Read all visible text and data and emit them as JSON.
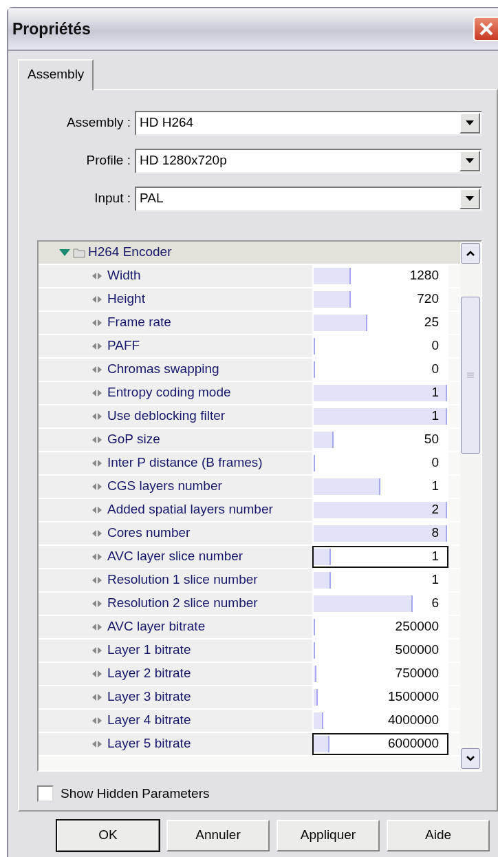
{
  "window": {
    "title": "Propriétés"
  },
  "tabs": [
    {
      "label": "Assembly",
      "selected": true
    }
  ],
  "selectors": [
    {
      "label": "Assembly :",
      "value": "HD H264"
    },
    {
      "label": "Profile :",
      "value": "HD 1280x720p"
    },
    {
      "label": "Input :",
      "value": "PAL"
    }
  ],
  "property_grid": {
    "groups": [
      {
        "label": "H264 Encoder",
        "expanded": true,
        "children": [
          {
            "label": "Width",
            "value": "1280",
            "level": 0.28,
            "editing": false
          },
          {
            "label": "Height",
            "value": "720",
            "level": 0.28,
            "editing": false
          },
          {
            "label": "Frame rate",
            "value": "25",
            "level": 0.4,
            "editing": false
          },
          {
            "label": "PAFF",
            "value": "0",
            "level": 0.01,
            "editing": false
          },
          {
            "label": "Chromas swapping",
            "value": "0",
            "level": 0,
            "editing": false
          },
          {
            "label": "Entropy coding mode",
            "value": "1",
            "level": 1,
            "editing": false
          },
          {
            "label": "Use deblocking filter",
            "value": "1",
            "level": 1,
            "editing": false
          },
          {
            "label": "GoP size",
            "value": "50",
            "level": 0.15,
            "editing": false
          },
          {
            "label": "Inter P distance (B frames)",
            "value": "0",
            "level": 0.01,
            "editing": false
          },
          {
            "label": "CGS layers number",
            "value": "1",
            "level": 0.5,
            "editing": false
          },
          {
            "label": "Added spatial layers number",
            "value": "2",
            "level": 1,
            "editing": false
          },
          {
            "label": "Cores number",
            "value": "8",
            "level": 1,
            "editing": false
          },
          {
            "label": "AVC layer slice number",
            "value": "1",
            "level": 0.13,
            "editing": true
          },
          {
            "label": "Resolution 1 slice number",
            "value": "1",
            "level": 0.13,
            "editing": false
          },
          {
            "label": "Resolution 2 slice number",
            "value": "6",
            "level": 0.74,
            "editing": false
          },
          {
            "label": "AVC layer bitrate",
            "value": "250000",
            "level": 0.01,
            "editing": false
          },
          {
            "label": "Layer 1 bitrate",
            "value": "500000",
            "level": 0.01,
            "editing": false
          },
          {
            "label": "Layer 2 bitrate",
            "value": "750000",
            "level": 0.02,
            "editing": false
          },
          {
            "label": "Layer 3 bitrate",
            "value": "1500000",
            "level": 0.03,
            "editing": false
          },
          {
            "label": "Layer 4 bitrate",
            "value": "4000000",
            "level": 0.07,
            "editing": false
          },
          {
            "label": "Layer 5 bitrate",
            "value": "6000000",
            "level": 0.12,
            "editing": true
          }
        ]
      }
    ]
  },
  "show_hidden": {
    "label": "Show Hidden Parameters",
    "checked": false
  },
  "buttons": [
    {
      "label": "OK",
      "default": true
    },
    {
      "label": "Annuler",
      "default": false
    },
    {
      "label": "Appliquer",
      "default": false
    },
    {
      "label": "Aide",
      "default": false
    }
  ]
}
